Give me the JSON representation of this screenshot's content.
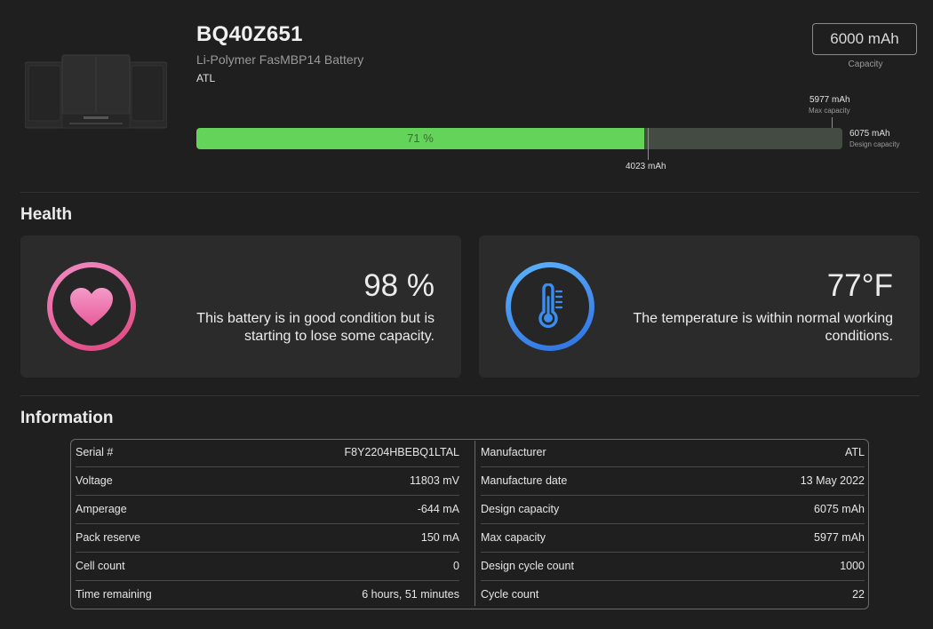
{
  "header": {
    "title": "BQ40Z651",
    "subtitle": "Li-Polymer FasMBP14 Battery",
    "manufacturer": "ATL",
    "capacity_value": "6000 mAh",
    "capacity_label": "Capacity"
  },
  "charge_bar": {
    "percent_label": "71 %",
    "current_label": "4023 mAh",
    "max_value": "5977 mAh",
    "max_label": "Max capacity",
    "design_value": "6075 mAh",
    "design_label": "Design capacity",
    "fill_color": "#63d35a",
    "current_mAh": 4023,
    "max_mAh": 5977,
    "design_mAh": 6075
  },
  "health": {
    "section_title": "Health",
    "battery": {
      "value": "98 %",
      "line1": "This battery is in good condition but is",
      "line2": "starting to lose some capacity.",
      "icon": "heart-icon",
      "accent": "#e86aa8"
    },
    "temperature": {
      "value": "77°F",
      "line1": "The temperature is within normal working",
      "line2": "conditions.",
      "icon": "thermometer-icon",
      "accent": "#3a8ef0"
    }
  },
  "information": {
    "section_title": "Information",
    "left": [
      {
        "key": "Serial #",
        "value": "F8Y2204HBEBQ1LTAL"
      },
      {
        "key": "Voltage",
        "value": "11803 mV"
      },
      {
        "key": "Amperage",
        "value": "-644 mA"
      },
      {
        "key": "Pack reserve",
        "value": "150 mA"
      },
      {
        "key": "Cell count",
        "value": "0"
      },
      {
        "key": "Time remaining",
        "value": "6 hours, 51 minutes"
      }
    ],
    "right": [
      {
        "key": "Manufacturer",
        "value": "ATL"
      },
      {
        "key": "Manufacture date",
        "value": "13 May 2022"
      },
      {
        "key": "Design capacity",
        "value": "6075 mAh"
      },
      {
        "key": "Max capacity",
        "value": "5977 mAh"
      },
      {
        "key": "Design cycle count",
        "value": "1000"
      },
      {
        "key": "Cycle count",
        "value": "22"
      }
    ]
  }
}
